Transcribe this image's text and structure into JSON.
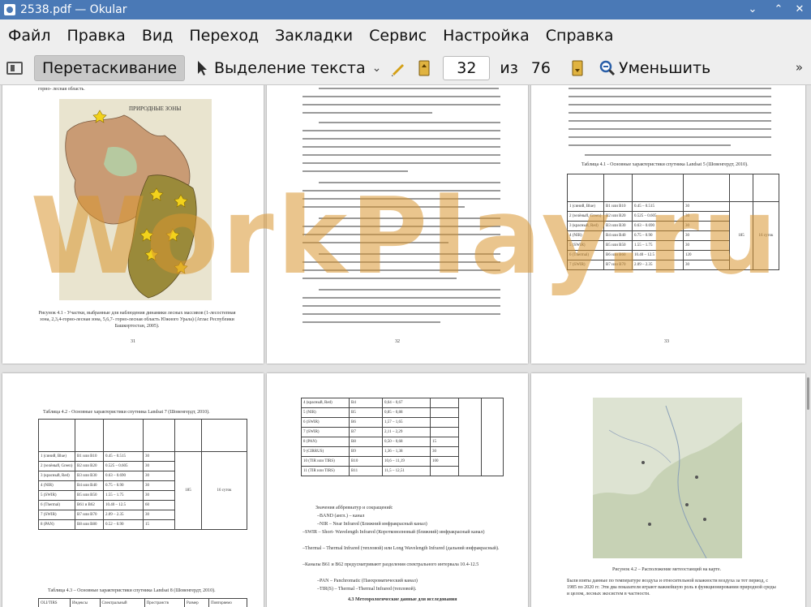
{
  "window": {
    "title": "2538.pdf  — Okular",
    "controls": [
      "⌄",
      "⌃",
      "✕"
    ]
  },
  "menu": [
    "Файл",
    "Правка",
    "Вид",
    "Переход",
    "Закладки",
    "Сервис",
    "Настройка",
    "Справка"
  ],
  "toolbar": {
    "browse_label": "Перетаскивание",
    "select_label": "Выделение текста",
    "page_current": "32",
    "of_label": "из",
    "page_total": "76",
    "zoom_out_label": "Уменьшить",
    "more": "»"
  },
  "pages": {
    "p31": {
      "header": "горно- лесная область.",
      "map_title": "ПРИРОДНЫЕ ЗОНЫ",
      "caption": "Рисунок 4.1 - Участки, выбранные для наблюдения динамики лесных массивов (1-лесостепная зона, 2,3,4-горно-лесная зона, 5,6,7- горно-лесная область Южного Урала) (Атлас Республики Башкортостан, 2005).",
      "number": "31"
    },
    "p32": {
      "number": "32"
    },
    "p33": {
      "table_title": "Таблица 4.1 - Основные характеристики спутника Landsat 5 (Шовенгердт, 2010).",
      "number": "33",
      "rows": [
        [
          "1 (синий, Blue)",
          "B1 или B10",
          "0.45 – 0.515",
          "30"
        ],
        [
          "2 (зелёный, Green)",
          "B2 или B20",
          "0.525 – 0.605",
          "30"
        ],
        [
          "3 (красный, Red)",
          "B3 или B30",
          "0.63 – 0.690",
          "30"
        ],
        [
          "4 (NIR)",
          "B4 или B40",
          "0.75 – 0.90",
          "30"
        ],
        [
          "5 (SWIR)",
          "B5 или B50",
          "1.55 – 1.75",
          "30"
        ],
        [
          "6 (Thermal)",
          "B6 или B60",
          "10.40 – 12.5",
          "120"
        ],
        [
          "7 (SWIR)",
          "B7 или B70",
          "2.09 – 2.35",
          "30"
        ]
      ],
      "span_values": [
        "185",
        "16 суток"
      ]
    },
    "p34": {
      "table_title": "Таблица 4.2 - Основные характеристики спутника Landsat 7 (Шовенгердт, 2010).",
      "rows": [
        [
          "1 (синий, Blue)",
          "B1 или B10",
          "0.45 – 0.515",
          "30"
        ],
        [
          "2 (зелёный, Green)",
          "B2 или B20",
          "0.525 – 0.605",
          "30"
        ],
        [
          "3 (красный, Red)",
          "B3 или B30",
          "0.63 – 0.690",
          "30"
        ],
        [
          "4 (NIR)",
          "B4 или B40",
          "0.75 – 0.90",
          "30"
        ],
        [
          "5 (SWIR)",
          "B5 или B50",
          "1.55 – 1.75",
          "30"
        ],
        [
          "6 (Thermal)",
          "B61 и B62",
          "10.40 – 12.5",
          "60"
        ],
        [
          "7 (SWIR)",
          "B7 или B70",
          "2.09 – 2.35",
          "30"
        ],
        [
          "8 (PAN)",
          "B8 или B80",
          "0.52 – 0.90",
          "15"
        ]
      ],
      "span_values": [
        "185",
        "16 суток"
      ],
      "table2_title": "Таблица 4.3 – Основные характеристики спутника Landsat 8 (Шовенгердт, 2010).",
      "table2_head": [
        "OLI/TIRS",
        "Индексы",
        "Спектральный",
        "Пространств",
        "Размер",
        "Повторяемо"
      ]
    },
    "p35": {
      "rows": [
        [
          "4 (красный, Red)",
          "B4",
          "0,64 – 0,67",
          ""
        ],
        [
          "5 (NIR)",
          "B5",
          "0,85 – 0,88",
          ""
        ],
        [
          "6 (SWIR)",
          "B6",
          "1,57 – 1,65",
          ""
        ],
        [
          "7 (SWIR)",
          "B7",
          "2,11 – 2,29",
          ""
        ],
        [
          "8 (PAN)",
          "B8",
          "0,50 – 0,68",
          "15"
        ],
        [
          "9 (CIRRUS)",
          "B9",
          "1,36 – 1,38",
          "30"
        ],
        [
          "10 (TIR или TIRS)",
          "B10",
          "10,6 – 11,19",
          "100"
        ],
        [
          "11 (TIR или TIRS)",
          "B11",
          "11,5 – 12,51",
          ""
        ]
      ],
      "notes": [
        "Значения аббревиатур и сокращений:",
        "–BAND (англ.) – канал",
        "–NIR – Near Infrared (Ближний инфракрасный канал)",
        "–SWIR – Short- Wavelength Infrared (Коротковолновый (ближний) инфракрасный канал)",
        "–Thermal – Thermal Infrared (тепловой) или Long Wavelength Infrared (дальний инфракрасный).",
        "–Каналы B61 и B62 предусматривают разделения спектрального интервала 10.4-12.5",
        "–PAN – Panchromatic (Панхроматический канал)",
        "–TIR(S) – Thermal –Thermal Infrared (тепловой)."
      ],
      "heading": "4.3 Метеорологические данные для исследования"
    },
    "p36": {
      "caption": "Рисунок 4.2 – Расположение метеостанций на карте.",
      "text": "Были взяты данные по температуре воздуха и относительной влажности воздуха за тот период, с 1985 по 2020 гг. Эти два показателя играют важнейшую роль в функционировании природной среды и целом, лесных экосистем в частности."
    }
  },
  "watermark": "WorkPlay.ru"
}
